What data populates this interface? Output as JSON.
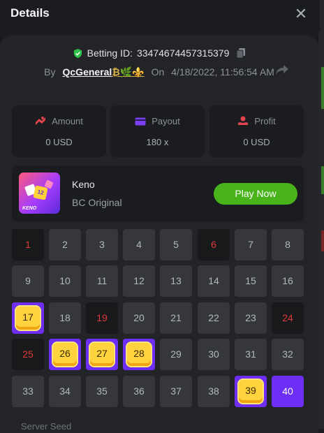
{
  "dialog": {
    "title": "Details"
  },
  "bet": {
    "id_label": "Betting ID:",
    "id_value": "33474674457315379",
    "by_label": "By",
    "user": "QcGeneral",
    "user_emojis": "₿🌿⚜️",
    "on_label": "On",
    "datetime": "4/18/2022, 11:56:54 AM"
  },
  "stats": {
    "amount": {
      "label": "Amount",
      "value": "0 USD"
    },
    "payout": {
      "label": "Payout",
      "value": "180 x"
    },
    "profit": {
      "label": "Profit",
      "value": "0 USD"
    }
  },
  "game": {
    "name": "Keno",
    "subtitle": "BC Original",
    "thumb_label": "KENO",
    "thumb_tile": "12",
    "play_label": "Play Now"
  },
  "grid": {
    "cells": [
      {
        "n": "1",
        "s": "miss"
      },
      {
        "n": "2",
        "s": "none"
      },
      {
        "n": "3",
        "s": "none"
      },
      {
        "n": "4",
        "s": "none"
      },
      {
        "n": "5",
        "s": "none"
      },
      {
        "n": "6",
        "s": "miss"
      },
      {
        "n": "7",
        "s": "none"
      },
      {
        "n": "8",
        "s": "none"
      },
      {
        "n": "9",
        "s": "none"
      },
      {
        "n": "10",
        "s": "none"
      },
      {
        "n": "11",
        "s": "none"
      },
      {
        "n": "12",
        "s": "none"
      },
      {
        "n": "13",
        "s": "none"
      },
      {
        "n": "14",
        "s": "none"
      },
      {
        "n": "15",
        "s": "none"
      },
      {
        "n": "16",
        "s": "none"
      },
      {
        "n": "17",
        "s": "gem"
      },
      {
        "n": "18",
        "s": "none"
      },
      {
        "n": "19",
        "s": "miss"
      },
      {
        "n": "20",
        "s": "none"
      },
      {
        "n": "21",
        "s": "none"
      },
      {
        "n": "22",
        "s": "none"
      },
      {
        "n": "23",
        "s": "none"
      },
      {
        "n": "24",
        "s": "miss"
      },
      {
        "n": "25",
        "s": "miss"
      },
      {
        "n": "26",
        "s": "gem"
      },
      {
        "n": "27",
        "s": "gem"
      },
      {
        "n": "28",
        "s": "gem"
      },
      {
        "n": "29",
        "s": "none"
      },
      {
        "n": "30",
        "s": "none"
      },
      {
        "n": "31",
        "s": "none"
      },
      {
        "n": "32",
        "s": "none"
      },
      {
        "n": "33",
        "s": "none"
      },
      {
        "n": "34",
        "s": "none"
      },
      {
        "n": "35",
        "s": "none"
      },
      {
        "n": "36",
        "s": "none"
      },
      {
        "n": "37",
        "s": "none"
      },
      {
        "n": "38",
        "s": "none"
      },
      {
        "n": "39",
        "s": "gem"
      },
      {
        "n": "40",
        "s": "hitd"
      }
    ]
  },
  "footer": {
    "server_seed_label": "Server Seed"
  },
  "colors": {
    "accent_green": "#49b31c",
    "hit_purple": "#6d2ef5",
    "miss_red": "#e03a3a",
    "gem_yellow": "#ffd33d"
  },
  "icons": [
    "close-icon",
    "share-icon",
    "shield-check-icon",
    "copy-icon",
    "amount-icon",
    "payout-card-icon",
    "profit-icon"
  ]
}
